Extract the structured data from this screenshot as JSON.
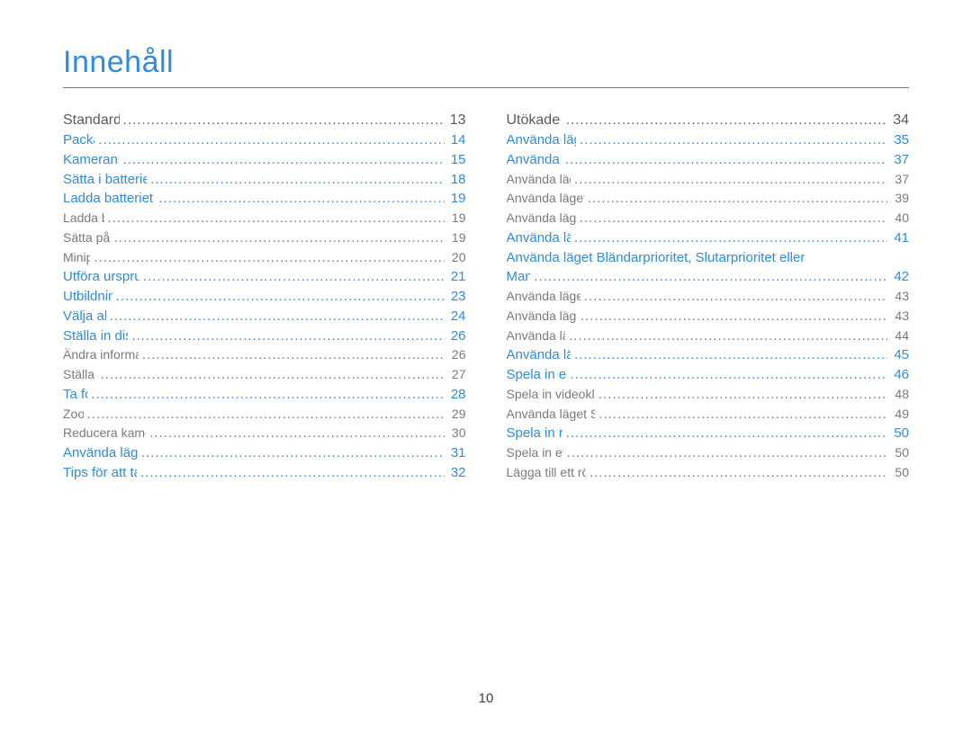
{
  "title": "Innehåll",
  "page_number": "10",
  "columns": [
    [
      {
        "label": "Standardfunktioner",
        "page": "13",
        "level": "section"
      },
      {
        "label": "Packa upp",
        "page": "14",
        "level": "blue"
      },
      {
        "label": "Kamerans utseende",
        "page": "15",
        "level": "blue"
      },
      {
        "label": "Sätta i batteriet och minneskortet",
        "page": "18",
        "level": "blue"
      },
      {
        "label": "Ladda batteriet och sätta på kameran",
        "page": "19",
        "level": "blue"
      },
      {
        "label": "Ladda batteriet",
        "page": "19",
        "level": "sub"
      },
      {
        "label": "Sätta på kameran",
        "page": "19",
        "level": "sub"
      },
      {
        "label": "Minipanel",
        "page": "20",
        "level": "sub"
      },
      {
        "label": "Utföra ursprungsinställningen",
        "page": "21",
        "level": "blue"
      },
      {
        "label": "Utbildningsikoner",
        "page": "23",
        "level": "blue"
      },
      {
        "label": "Välja alternativ",
        "page": "24",
        "level": "blue"
      },
      {
        "label": "Ställa in display och ljud",
        "page": "26",
        "level": "blue"
      },
      {
        "label": "Ändra informationen som visas",
        "page": "26",
        "level": "sub"
      },
      {
        "label": "Ställa in ljud",
        "page": "27",
        "level": "sub"
      },
      {
        "label": "Ta foton",
        "page": "28",
        "level": "blue"
      },
      {
        "label": "Zooma",
        "page": "29",
        "level": "sub"
      },
      {
        "label": "Reducera kameraskakningar (OIS)",
        "page": "30",
        "level": "sub"
      },
      {
        "label": "Använda lägesväljarenheten",
        "page": "31",
        "level": "blue"
      },
      {
        "label": "Tips för att ta skarpare foton",
        "page": "32",
        "level": "blue"
      }
    ],
    [
      {
        "label": "Utökade funktioner",
        "page": "34",
        "level": "section"
      },
      {
        "label": "Använda läget Smart Auto",
        "page": "35",
        "level": "blue"
      },
      {
        "label": "Använda motivläget",
        "page": "37",
        "level": "blue"
      },
      {
        "label": "Använda läget Panorama",
        "page": "37",
        "level": "sub"
      },
      {
        "label": "Använda läget Action-panorama",
        "page": "39",
        "level": "sub"
      },
      {
        "label": "Använda läget Skönhetsbild",
        "page": "40",
        "level": "sub"
      },
      {
        "label": "Använda läget Program",
        "page": "41",
        "level": "blue"
      },
      {
        "label": "Använda läget Bländarprioritet, Slutarprioritet eller",
        "page": "",
        "level": "blue",
        "continued": true
      },
      {
        "label": "Manuell",
        "page": "42",
        "level": "blue"
      },
      {
        "label": "Använda läget Bländarprioritet",
        "page": "43",
        "level": "sub"
      },
      {
        "label": "Använda läget Slutarprioritet",
        "page": "43",
        "level": "sub"
      },
      {
        "label": "Använda läget Manuell",
        "page": "44",
        "level": "sub"
      },
      {
        "label": "Använda läget DUAL IS",
        "page": "45",
        "level": "blue"
      },
      {
        "label": "Spela in ett videoklipp",
        "page": "46",
        "level": "blue"
      },
      {
        "label": "Spela in videoklipp med hög hastighet",
        "page": "48",
        "level": "sub"
      },
      {
        "label": "Använda läget Smart Scene Detection",
        "page": "49",
        "level": "sub"
      },
      {
        "label": "Spela in röstmemon",
        "page": "50",
        "level": "blue"
      },
      {
        "label": "Spela in ett röstmemo",
        "page": "50",
        "level": "sub"
      },
      {
        "label": "Lägga till ett röstmemo till ett foto",
        "page": "50",
        "level": "sub"
      }
    ]
  ]
}
